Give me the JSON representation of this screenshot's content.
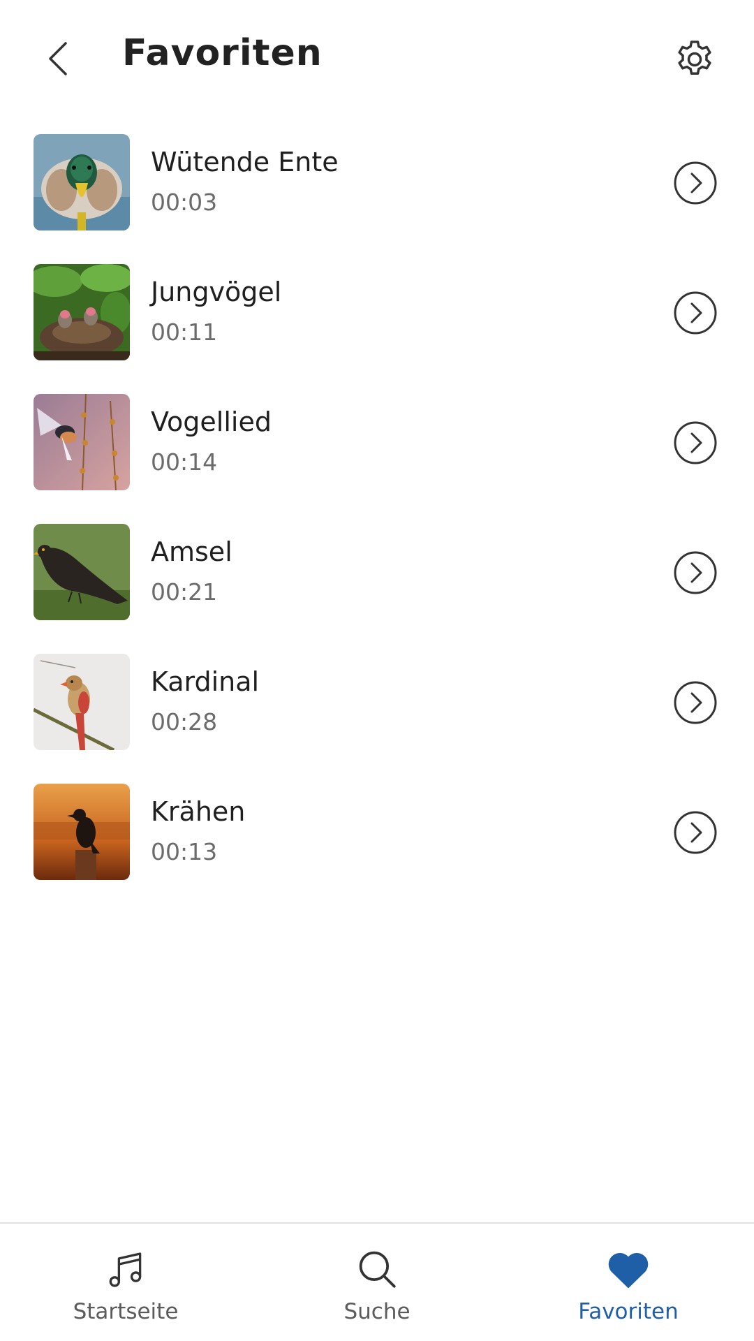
{
  "header": {
    "title": "Favoriten",
    "back_icon": "chevron-left-icon",
    "settings_icon": "gear-icon"
  },
  "favorites": [
    {
      "title": "Wütende Ente",
      "duration": "00:03",
      "image": "duck"
    },
    {
      "title": "Jungvögel",
      "duration": "00:11",
      "image": "nestlings"
    },
    {
      "title": "Vogellied",
      "duration": "00:14",
      "image": "songbird"
    },
    {
      "title": "Amsel",
      "duration": "00:21",
      "image": "blackbird"
    },
    {
      "title": "Kardinal",
      "duration": "00:28",
      "image": "cardinal"
    },
    {
      "title": "Krähen",
      "duration": "00:13",
      "image": "crow"
    }
  ],
  "bottom_nav": {
    "items": [
      {
        "label": "Startseite",
        "icon": "music-note-icon",
        "active": false
      },
      {
        "label": "Suche",
        "icon": "search-icon",
        "active": false
      },
      {
        "label": "Favoriten",
        "icon": "heart-icon",
        "active": true
      }
    ]
  },
  "colors": {
    "accent": "#1f5fa8",
    "text_primary": "#1f1f1f",
    "text_secondary": "#6b6b6b",
    "icon": "#333333"
  }
}
